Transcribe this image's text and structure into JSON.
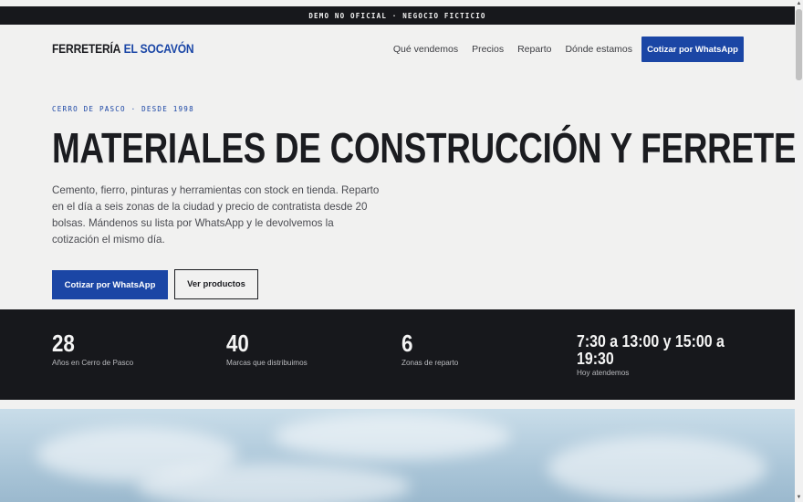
{
  "topbar": {
    "text": "DEMO NO OFICIAL · NEGOCIO FICTICIO"
  },
  "nav": {
    "logo_part1": "FERRETERÍA",
    "logo_part2": "EL SOCAVÓN",
    "links": [
      "Qué vendemos",
      "Precios",
      "Reparto",
      "Dónde estamos"
    ],
    "cta": "Cotizar por WhatsApp"
  },
  "hero": {
    "eyebrow": "CERRO DE PASCO · DESDE 1998",
    "title": "MATERIALES DE CONSTRUCCIÓN Y FERRETERÍA",
    "description": "Cemento, fierro, pinturas y herramientas con stock en tienda. Reparto en el día a seis zonas de la ciudad y precio de contratista desde 20 bolsas. Mándenos su lista por WhatsApp y le devolvemos la cotización el mismo día.",
    "primary_button": "Cotizar por WhatsApp",
    "secondary_button": "Ver productos"
  },
  "stats": [
    {
      "value": "28",
      "label": "Años en Cerro de Pasco"
    },
    {
      "value": "40",
      "label": "Marcas que distribuimos"
    },
    {
      "value": "6",
      "label": "Zonas de reparto"
    },
    {
      "value": "7:30 a 13:00 y 15:00 a 19:30",
      "label": "Hoy atendemos"
    }
  ],
  "colors": {
    "accent": "#1b46a5",
    "dark": "#17181c",
    "background": "#f1f1f0"
  },
  "icons": {
    "scroll_up": "triangle-up-icon",
    "scroll_down": "triangle-down-icon"
  }
}
